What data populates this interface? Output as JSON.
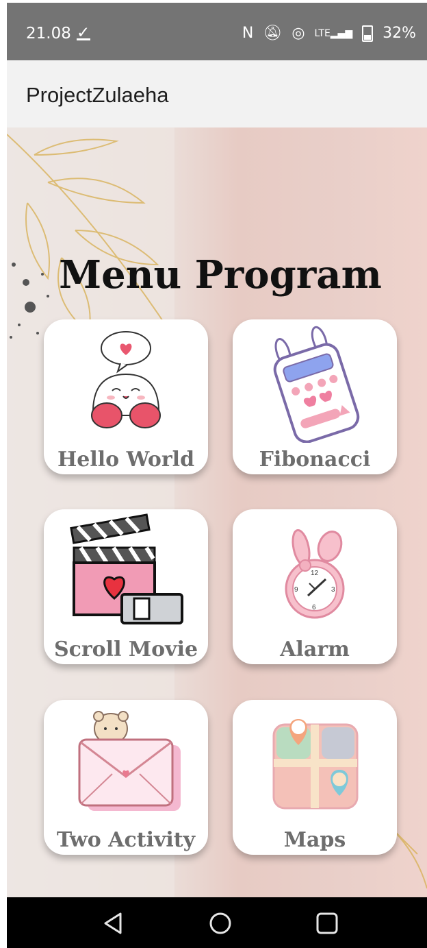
{
  "status_bar": {
    "time": "21.08",
    "battery": "32%",
    "icons": [
      "download-done-icon",
      "nfc-icon",
      "mute-icon",
      "hotspot-icon",
      "lte-signal-icon",
      "battery-icon"
    ]
  },
  "app_bar": {
    "title": "ProjectZulaeha"
  },
  "menu": {
    "title": "Menu Program",
    "items": [
      {
        "label": "Hello World",
        "icon": "cute-character-icon"
      },
      {
        "label": "Fibonacci",
        "icon": "calculator-icon"
      },
      {
        "label": "Scroll Movie",
        "icon": "clapperboard-icon"
      },
      {
        "label": "Alarm",
        "icon": "alarm-clock-icon"
      },
      {
        "label": "Two Activity",
        "icon": "envelope-icon"
      },
      {
        "label": "Maps",
        "icon": "map-icon"
      }
    ]
  },
  "nav_bar": {
    "buttons": [
      "back-icon",
      "home-icon",
      "recents-icon"
    ]
  }
}
